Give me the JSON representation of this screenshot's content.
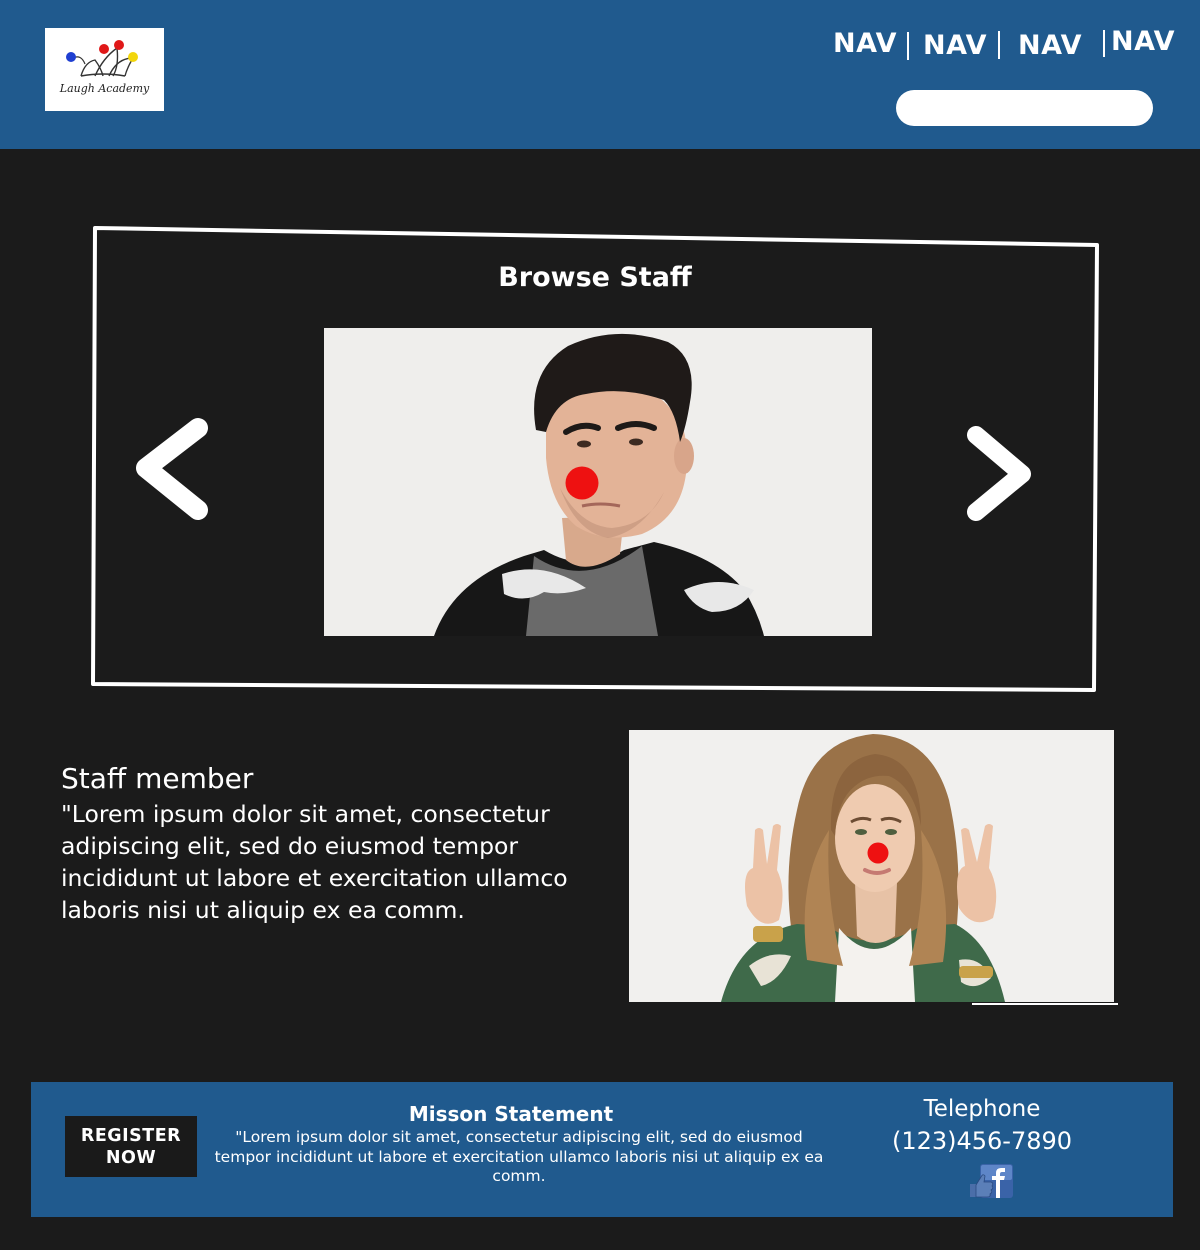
{
  "header": {
    "logo_text": "Laugh Academy",
    "nav": [
      "NAV",
      "NAV",
      "NAV",
      "NAV"
    ],
    "search_placeholder": ""
  },
  "carousel": {
    "title": "Browse Staff",
    "prev_icon": "chevron-left-icon",
    "next_icon": "chevron-right-icon"
  },
  "staff": {
    "name": "Staff member",
    "bio": "\"Lorem ipsum dolor sit amet, consectetur adipiscing elit, sed do eiusmod tempor incididunt ut labore et exercitation ullamco laboris nisi ut aliquip ex ea comm."
  },
  "footer": {
    "register_line1": "REGISTER",
    "register_line2": "NOW",
    "mission_title": "Misson Statement",
    "mission_text": "\"Lorem ipsum dolor sit amet, consectetur adipiscing elit, sed do eiusmod tempor incididunt ut labore et  exercitation ullamco laboris nisi ut aliquip ex ea comm.",
    "telephone_label": "Telephone",
    "telephone_number": "(123)456-7890",
    "social_icon": "facebook-like-icon"
  },
  "colors": {
    "header_blue": "#205a8e",
    "page_background": "#1b1b1b",
    "clown_nose_red": "#ee1111"
  }
}
